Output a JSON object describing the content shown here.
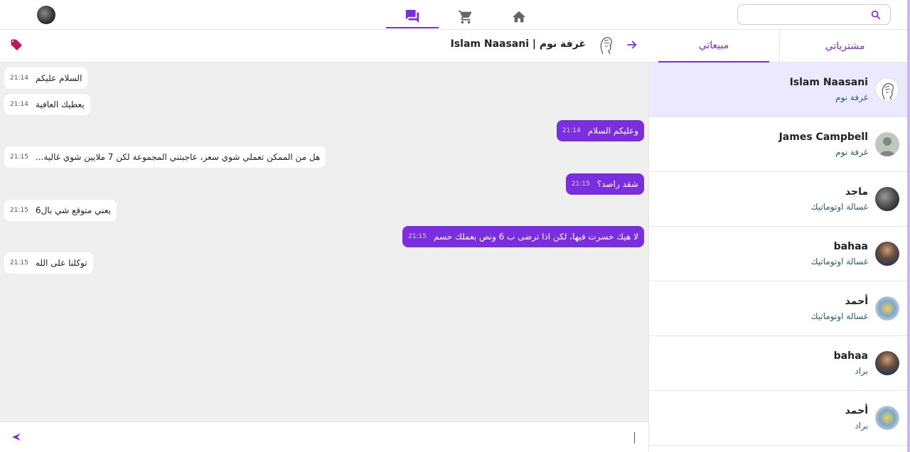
{
  "topbar": {
    "search_placeholder": "",
    "nav": [
      {
        "name": "messages",
        "icon": "chat-icon",
        "active": true
      },
      {
        "name": "cart",
        "icon": "cart-icon",
        "active": false
      },
      {
        "name": "home",
        "icon": "home-icon",
        "active": false
      }
    ]
  },
  "chat_header": {
    "title": "Islam Naasani | غرفة نوم"
  },
  "tabs": {
    "sales": "مبيعاتي",
    "purchases": "مشترياتي"
  },
  "messages": [
    {
      "dir": "in",
      "text": "السلام عليكم",
      "time": "21:14"
    },
    {
      "dir": "in",
      "text": "يعطيك العافية",
      "time": "21:14"
    },
    {
      "dir": "out",
      "text": "وعليكم السلام",
      "time": "21:14"
    },
    {
      "dir": "in",
      "text": "هل من الممكن تعملي شوي سعر، عاجبتني المجموعة لكن 7 ملايين شوي غالية...",
      "time": "21:15"
    },
    {
      "dir": "out",
      "text": "شقد راصد؟",
      "time": "21:15"
    },
    {
      "dir": "in",
      "text": "يعني متوقع شي بال6",
      "time": "21:15"
    },
    {
      "dir": "out",
      "text": "لا هيك خسرت فيها، لكن اذا ترضى ب 6 ونص بعملك حسم",
      "time": "21:15"
    },
    {
      "dir": "in",
      "text": "توكلنا على الله",
      "time": "21:15"
    }
  ],
  "composer": {
    "placeholder": ""
  },
  "conversations": [
    {
      "name": "Islam Naasani",
      "item": "غرفة نوم",
      "active": true
    },
    {
      "name": "James Campbell",
      "item": "غرفة نوم",
      "active": false
    },
    {
      "name": "ماجد",
      "item": "غسالة اوتوماتيك",
      "active": false
    },
    {
      "name": "bahaa",
      "item": "غسالة اوتوماتيك",
      "active": false
    },
    {
      "name": "أحمد",
      "item": "غسالة اوتوماتيك",
      "active": false
    },
    {
      "name": "bahaa",
      "item": "براد",
      "active": false
    },
    {
      "name": "أحمد",
      "item": "براد",
      "active": false
    }
  ],
  "colors": {
    "accent": "#7b2ee0",
    "active_row": "#ece8fd",
    "chat_bg": "#efefef",
    "tag": "#c2185b"
  }
}
